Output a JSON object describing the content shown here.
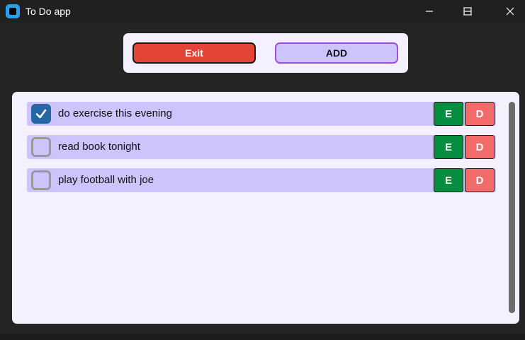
{
  "window": {
    "title": "To Do app",
    "controls": [
      "minimize-icon",
      "maximize-icon",
      "close-icon"
    ]
  },
  "toolbar": {
    "exit_label": "Exit",
    "add_label": "ADD"
  },
  "tasks": [
    {
      "label": "do exercise this evening",
      "checked": true,
      "edit_label": "E",
      "delete_label": "D"
    },
    {
      "label": "read book tonight",
      "checked": false,
      "edit_label": "E",
      "delete_label": "D"
    },
    {
      "label": "play football with joe",
      "checked": false,
      "edit_label": "E",
      "delete_label": "D"
    }
  ],
  "colors": {
    "exit": "#e44436",
    "add": "#cdc4fb",
    "add_border": "#a14be6",
    "edit": "#078d3f",
    "delete": "#f26b6b",
    "row": "#cdc4fb",
    "checkbox_checked": "#2766a5"
  }
}
